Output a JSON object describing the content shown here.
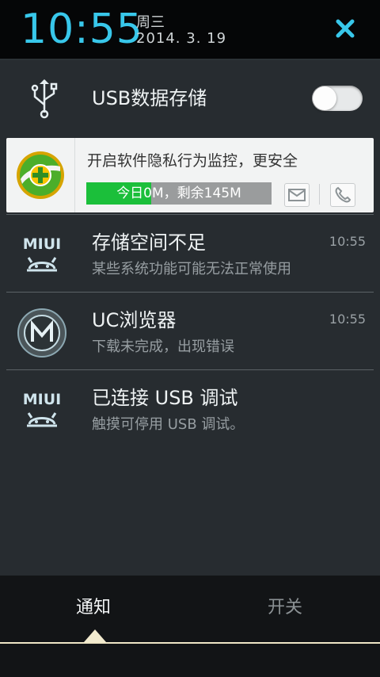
{
  "status_header": {
    "time": "10:55",
    "weekday": "周三",
    "date": "2014. 3. 19",
    "close_icon": "close-icon",
    "accent_color": "#38c7ea"
  },
  "usb_storage": {
    "label": "USB数据存储",
    "toggle_state": "off",
    "icon": "usb-icon"
  },
  "security_card": {
    "text": "开启软件隐私行为监控，更安全",
    "progress_text": "今日0M，剩余145M",
    "progress_fill_fraction": 0.35,
    "fill_color": "#1bbf3a",
    "logo_icon": "360-security-icon",
    "mail_icon": "mail-icon",
    "phone_icon": "phone-icon"
  },
  "notifications": [
    {
      "title": "存储空间不足",
      "description": "某些系统功能可能无法正常使用",
      "time": "10:55",
      "icon": "miui-android-icon"
    },
    {
      "title": "UC浏览器",
      "description": "下载未完成，出现错误",
      "time": "10:55",
      "icon": "m-circle-icon"
    },
    {
      "title": "已连接 USB 调试",
      "description": "触摸可停用 USB 调试。",
      "time": "",
      "icon": "miui-android-icon"
    }
  ],
  "miui_label": "MIUI",
  "bottom_tabs": {
    "notify": "通知",
    "switches": "开关",
    "active_tab": "notify"
  }
}
